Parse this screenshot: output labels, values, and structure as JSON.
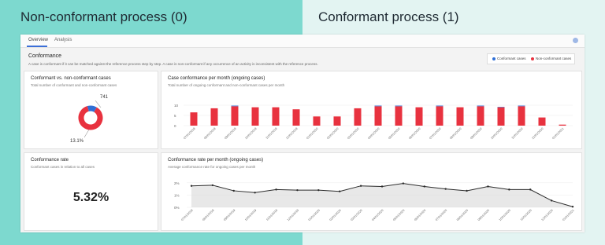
{
  "headers": {
    "left": "Non-conformant process (0)",
    "right": "Conformant process (1)"
  },
  "tabs": [
    "Overview",
    "Analysis"
  ],
  "section": {
    "title": "Conformance",
    "description": "A case is conformant if it can be matched against the reference process step by step. A case is non-conformant if any occurrence of an activity is inconsistent with the reference process."
  },
  "legend": {
    "conformant": "Conformant cases",
    "non_conformant": "Non-conformant cases"
  },
  "cards": {
    "donut": {
      "title": "Conformant vs. non-conformant cases",
      "subtitle": "Total number of conformant and non-conformant cases",
      "label_top": "741",
      "label_bottom": "13.1%"
    },
    "bar": {
      "title": "Case conformance per month (ongoing cases)",
      "subtitle": "Total number of ongoing conformant and non-conformant cases per month"
    },
    "rate": {
      "title": "Conformance rate",
      "subtitle": "Conformant cases in relation to all cases",
      "value": "5.32%"
    },
    "line": {
      "title": "Conformance rate per month (ongoing cases)",
      "subtitle": "Average conformance rate for ongoing cases per month"
    }
  },
  "colors": {
    "conformant": "#2f6fd6",
    "non_conformant": "#e8323f",
    "line": "#2b2b2b",
    "area": "#d9d9d9"
  },
  "chart_data": [
    {
      "type": "pie",
      "values": [
        741,
        112
      ],
      "labels": [
        "Non-conformant cases",
        "Conformant cases"
      ]
    },
    {
      "type": "bar",
      "categories": [
        "07/01/2019",
        "08/01/2019",
        "09/01/2019",
        "10/01/2019",
        "11/01/2019",
        "12/01/2019",
        "01/01/2020",
        "02/01/2020",
        "03/01/2020",
        "04/01/2020",
        "05/01/2020",
        "06/01/2020",
        "07/01/2020",
        "08/01/2020",
        "09/01/2020",
        "10/01/2020",
        "11/01/2020",
        "12/01/2020",
        "01/01/2021"
      ],
      "yticks": [
        "0",
        "5",
        "10"
      ],
      "ylim": [
        0,
        15
      ],
      "series": [
        {
          "name": "Non-conformant cases",
          "values": [
            6.5,
            8.5,
            9.5,
            9,
            9,
            8,
            4.5,
            4.5,
            8.5,
            9.5,
            9.5,
            9,
            9.5,
            9,
            9.5,
            9,
            9.5,
            4,
            0.5
          ]
        },
        {
          "name": "Conformant cases",
          "values": [
            0,
            0,
            0.3,
            0,
            0,
            0,
            0,
            0,
            0,
            0.3,
            0.3,
            0,
            0.3,
            0,
            0.3,
            0.2,
            0.3,
            0,
            0
          ]
        }
      ]
    },
    {
      "type": "area",
      "categories": [
        "07/01/2019",
        "08/01/2019",
        "09/01/2019",
        "10/01/2019",
        "11/01/2019",
        "12/01/2019",
        "01/01/2020",
        "02/01/2020",
        "03/01/2020",
        "04/01/2020",
        "05/01/2020",
        "06/01/2020",
        "07/01/2020",
        "08/01/2020",
        "09/01/2020",
        "10/01/2020",
        "11/01/2020",
        "12/01/2020",
        "01/01/2021"
      ],
      "yticks": [
        "0%",
        "1%",
        "2%"
      ],
      "ylim": [
        0,
        2.5
      ],
      "values": [
        1.75,
        1.8,
        1.35,
        1.2,
        1.45,
        1.4,
        1.4,
        1.3,
        1.75,
        1.7,
        1.95,
        1.7,
        1.5,
        1.35,
        1.7,
        1.45,
        1.45,
        0.55,
        0.05
      ]
    }
  ]
}
